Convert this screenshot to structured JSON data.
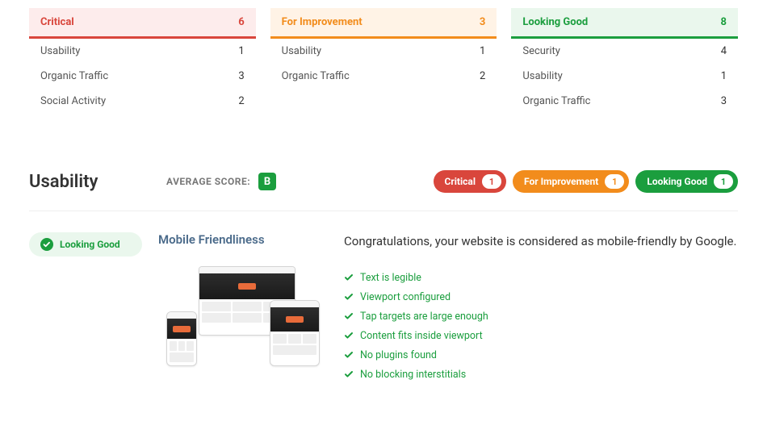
{
  "summary": {
    "critical": {
      "label": "Critical",
      "count": 6,
      "rows": [
        {
          "label": "Usability",
          "value": 1
        },
        {
          "label": "Organic Traffic",
          "value": 3
        },
        {
          "label": "Social Activity",
          "value": 2
        }
      ]
    },
    "improvement": {
      "label": "For Improvement",
      "count": 3,
      "rows": [
        {
          "label": "Usability",
          "value": 1
        },
        {
          "label": "Organic Traffic",
          "value": 2
        }
      ]
    },
    "good": {
      "label": "Looking Good",
      "count": 8,
      "rows": [
        {
          "label": "Security",
          "value": 4
        },
        {
          "label": "Usability",
          "value": 1
        },
        {
          "label": "Organic Traffic",
          "value": 3
        }
      ]
    }
  },
  "section": {
    "title": "Usability",
    "avg_label": "AVERAGE SCORE:",
    "score": "B",
    "pills": {
      "critical": {
        "label": "Critical",
        "count": 1
      },
      "improvement": {
        "label": "For Improvement",
        "count": 1
      },
      "good": {
        "label": "Looking Good",
        "count": 1
      }
    }
  },
  "audit": {
    "status_label": "Looking Good",
    "title": "Mobile Friendliness",
    "message": "Congratulations, your website is considered as mobile-friendly by Google.",
    "checks": [
      "Text is legible",
      "Viewport configured",
      "Tap targets are large enough",
      "Content fits inside viewport",
      "No plugins found",
      "No blocking interstitials"
    ]
  }
}
